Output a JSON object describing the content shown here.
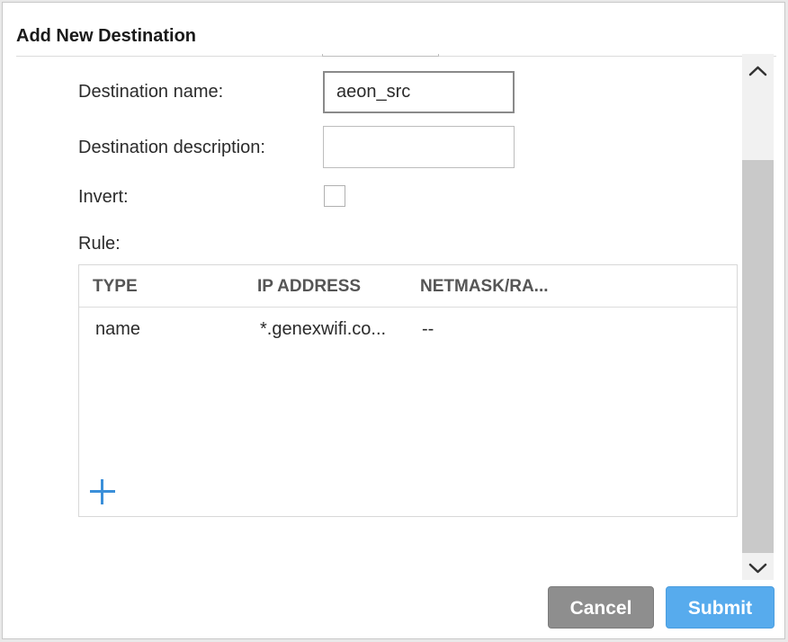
{
  "dialog": {
    "title": "Add New Destination"
  },
  "form": {
    "name_label": "Destination name:",
    "name_value": "aeon_src",
    "description_label": "Destination description:",
    "description_value": "",
    "invert_label": "Invert:",
    "invert_checked": false,
    "rule_label": "Rule:"
  },
  "rule_table": {
    "columns": [
      "TYPE",
      "IP ADDRESS",
      "NETMASK/RA..."
    ],
    "rows": [
      [
        "name",
        "*.genexwifi.co...",
        "--"
      ]
    ]
  },
  "footer": {
    "cancel_label": "Cancel",
    "submit_label": "Submit"
  },
  "colors": {
    "accent": "#3a8fd9",
    "submit_button": "#57abed",
    "cancel_button": "#8e8e8e"
  },
  "icons": {
    "add": "plus-icon",
    "scroll_up": "chevron-up-icon",
    "scroll_down": "chevron-down-icon"
  }
}
